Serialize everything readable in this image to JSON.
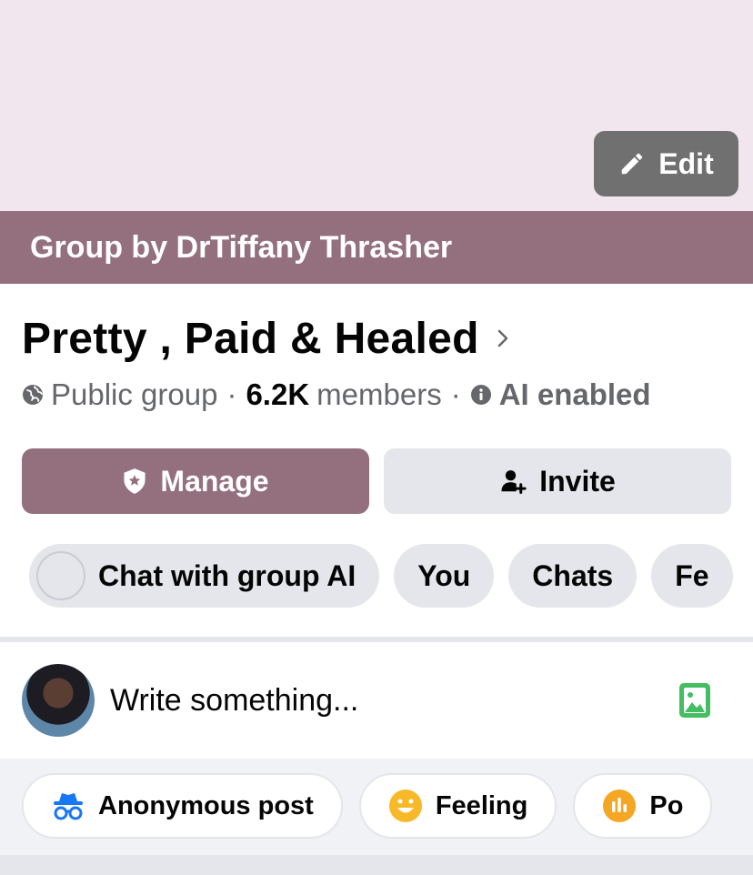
{
  "header": {
    "edit_label": "Edit",
    "group_by_text": "Group by DrTiffany Thrasher"
  },
  "group": {
    "name": "Pretty , Paid & Healed",
    "privacy": "Public group",
    "member_count": "6.2K",
    "members_label": "members",
    "separator": "·",
    "ai_status": "AI enabled"
  },
  "buttons": {
    "manage_label": "Manage",
    "invite_label": "Invite"
  },
  "chips": [
    {
      "label": "Chat with group AI"
    },
    {
      "label": "You"
    },
    {
      "label": "Chats"
    },
    {
      "label": "Fe"
    }
  ],
  "composer": {
    "placeholder": "Write something..."
  },
  "actions": [
    {
      "label": "Anonymous post",
      "icon": "incognito-icon"
    },
    {
      "label": "Feeling",
      "icon": "smiley-icon"
    },
    {
      "label": "Po",
      "icon": "poll-icon"
    }
  ],
  "colors": {
    "cover": "#f2e6ee",
    "brand": "#94707f",
    "edit_button": "#707070",
    "chip_bg": "#e4e6eb",
    "photo_icon": "#45bd62",
    "anonymous_icon": "#1877f2",
    "feeling_icon": "#f7b928",
    "poll_icon": "#f5a623"
  }
}
